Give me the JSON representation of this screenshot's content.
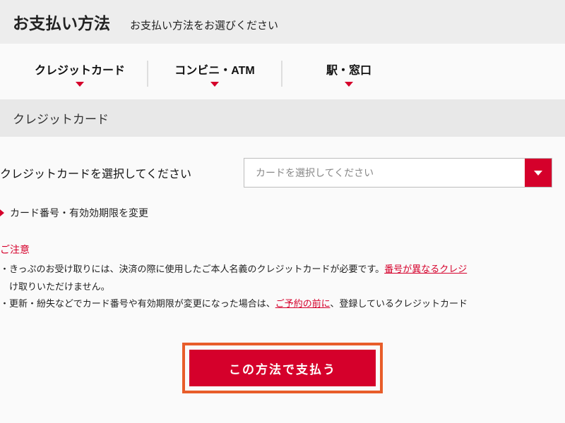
{
  "header": {
    "title": "お支払い方法",
    "subtitle": "お支払い方法をお選びください"
  },
  "tabs": [
    {
      "label": "クレジットカード"
    },
    {
      "label": "コンビニ・ATM"
    },
    {
      "label": "駅・窓口"
    }
  ],
  "section": {
    "title": "クレジットカード"
  },
  "form": {
    "select_label": "クレジットカードを選択してください",
    "select_placeholder": "カードを選択してください"
  },
  "change_link": "カード番号・有効効期限を変更",
  "notice": {
    "heading": "ご注意",
    "line1_a": "・きっぷのお受け取りには、決済の際に使用したご本人名義のクレジットカードが必要です。",
    "line1_link": "番号が異なるクレジ",
    "line1_b": "　け取りいただけません。",
    "line2_a": "・更新・紛失などでカード番号や有効期限が変更になった場合は、",
    "line2_link": "ご予約の前に",
    "line2_b": "、登録しているクレジットカード"
  },
  "pay_button": "この方法で支払う"
}
